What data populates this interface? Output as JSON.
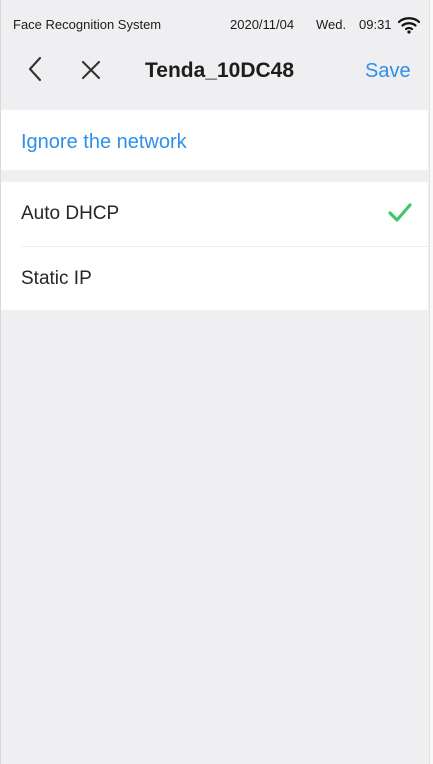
{
  "status_bar": {
    "app_name": "Face Recognition System",
    "date": "2020/11/04",
    "weekday": "Wed.",
    "time": "09:31",
    "wifi_icon": "wifi-icon"
  },
  "nav_bar": {
    "back_icon": "chevron-left-icon",
    "close_icon": "close-icon",
    "title": "Tenda_10DC48",
    "save_label": "Save"
  },
  "actions": {
    "ignore_network_label": "Ignore the network"
  },
  "ip_modes": [
    {
      "label": "Auto DHCP",
      "selected": true
    },
    {
      "label": "Static IP",
      "selected": false
    }
  ],
  "colors": {
    "accent": "#2F8FE9",
    "check": "#42C66B",
    "background": "#EFEFF1",
    "row_background": "#FFFFFF"
  }
}
